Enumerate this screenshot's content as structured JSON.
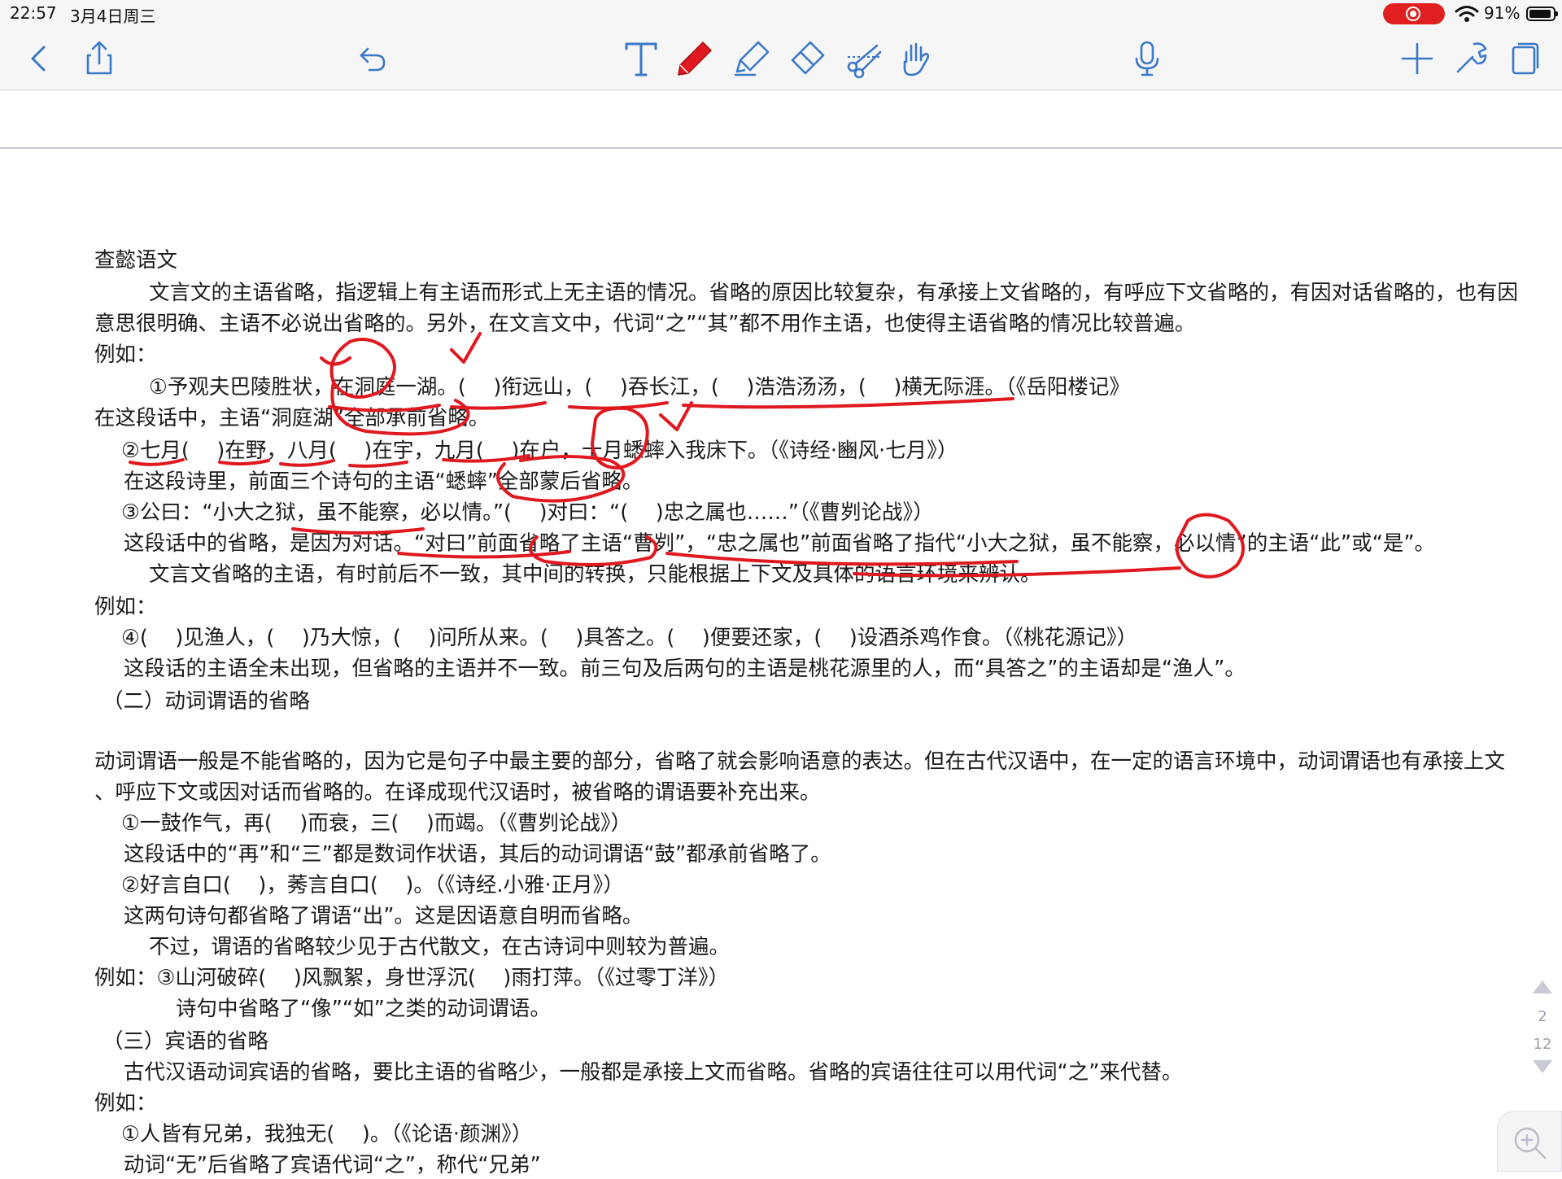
{
  "status_bar": {
    "time": "22:57",
    "date": "3月4日周三",
    "battery_percent": "91%"
  },
  "toolbar": {
    "icons": [
      "back-icon",
      "share-icon",
      "undo-icon",
      "text-tool-icon",
      "pen-tool-icon",
      "highlighter-icon",
      "eraser-icon",
      "lasso-icon",
      "hand-icon",
      "microphone-icon",
      "add-icon",
      "tools-icon",
      "pages-icon"
    ]
  },
  "colors": {
    "accent": "#3a78c9",
    "ink": "#e0181f",
    "record": "#e02020"
  },
  "document": {
    "lines": [
      "查懿语文",
      "文言文的主语省略，指逻辑上有主语而形式上无主语的情况。省略的原因比较复杂，有承接上文省略的，有呼应下文省略的，有因对话省略的，也有因",
      "意思很明确、主语不必说出省略的。另外，在文言文中，代词“之”“其”都不用作主语，也使得主语省略的情况比较普遍。",
      "例如：",
      "①予观夫巴陵胜状，在洞庭一湖。(　  )衔远山，(　  )吞长江，(　  )浩浩汤汤，(　  )横无际涯。（《岳阳楼记》",
      "在这段话中，主语“洞庭湖”全部承前省略。",
      "②七月(　  )在野，八月(　  )在宇，九月(　  )在户，十月蟋蟀入我床下。（《诗经·豳风·七月》）",
      "在这段诗里，前面三个诗句的主语“蟋蟀”全部蒙后省略。",
      "③公曰：“小大之狱，虽不能察，必以情。”(　  )对曰：“(　  )忠之属也……”（《曹刿论战》）",
      "这段话中的省略，是因为对话。“对曰”前面省略了主语“曹刿”，“忠之属也”前面省略了指代“小大之狱，虽不能察，必以情”的主语“此”或“是”。",
      "文言文省略的主语，有时前后不一致，其中间的转换，只能根据上下文及具体的语言环境来辨认。",
      "例如：",
      "④(　  )见渔人，(　  )乃大惊，(　  )问所从来。(　  )具答之。(　  )便要还家，(　  )设酒杀鸡作食。（《桃花源记》）",
      "这段话的主语全未出现，但省略的主语并不一致。前三句及后两句的主语是桃花源里的人，而“具答之”的主语却是“渔人”。",
      "（二）动词谓语的省略",
      "动词谓语一般是不能省略的，因为它是句子中最主要的部分，省略了就会影响语意的表达。但在古代汉语中，在一定的语言环境中，动词谓语也有承接上文",
      "、呼应下文或因对话而省略的。在译成现代汉语时，被省略的谓语要补充出来。",
      "①一鼓作气，再(　  )而衰，三(　  )而竭。（《曹刿论战》）",
      "这段话中的“再”和“三”都是数词作状语，其后的动词谓语“鼓”都承前省略了。",
      "②好言自口(　  )，莠言自口(　  )。（《诗经.小雅·正月》）",
      "这两句诗句都省略了谓语“出”。这是因语意自明而省略。",
      "不过，谓语的省略较少见于古代散文，在古诗词中则较为普遍。",
      "例如：③山河破碎(　  )风飘絮，身世浮沉(　  )雨打萍。（《过零丁洋》）",
      "诗句中省略了“像”“如”之类的动词谓语。",
      "（三）宾语的省略",
      "古代汉语动词宾语的省略，要比主语的省略少，一般都是承接上文而省略。省略的宾语往往可以用代词“之”来代替。",
      "例如：",
      "①人皆有兄弟，我独无(　  )。（《论语·颜渊》）",
      "动词“无”后省略了宾语代词“之”，称代“兄弟”"
    ]
  },
  "page_indicator": {
    "current": "2",
    "total": "12"
  }
}
